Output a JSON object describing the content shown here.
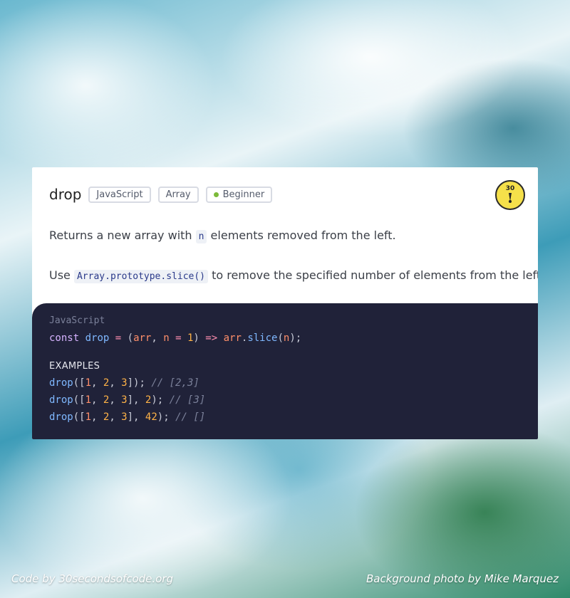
{
  "card": {
    "title": "drop",
    "tags": [
      {
        "label": "JavaScript"
      },
      {
        "label": "Array"
      },
      {
        "label": "Beginner",
        "dot_color": "#7cba3a"
      }
    ],
    "logo": {
      "text": "30"
    },
    "description": {
      "part1": "Returns a new array with ",
      "code": "n",
      "part2": " elements removed from the left."
    },
    "usage": {
      "part1": "Use ",
      "code": "Array.prototype.slice()",
      "part2": " to remove the specified number of elements from the left."
    }
  },
  "code": {
    "language_label": "JavaScript",
    "definition": {
      "const": "const",
      "name": "drop",
      "assign": "=",
      "open_paren": "(",
      "param1": "arr",
      "comma": ",",
      "param2": "n",
      "default_assign": "=",
      "default_value": "1",
      "close_paren": ")",
      "arrow": "=>",
      "target": "arr",
      "dot": ".",
      "method": "slice",
      "call_open": "(",
      "arg": "n",
      "call_close": ");"
    },
    "examples_label": "EXAMPLES",
    "examples": [
      {
        "fn": "drop",
        "args": [
          "1",
          "2",
          "3"
        ],
        "extra": "",
        "comment": "// [2,3]"
      },
      {
        "fn": "drop",
        "args": [
          "1",
          "2",
          "3"
        ],
        "extra": "2",
        "comment": "// [3]"
      },
      {
        "fn": "drop",
        "args": [
          "1",
          "2",
          "3"
        ],
        "extra": "42",
        "comment": "// []"
      }
    ]
  },
  "footer": {
    "left": "Code by 30secondsofcode.org",
    "right": "Background photo by Mike Marquez"
  },
  "colors": {
    "code_background": "#202239",
    "card_background": "#ffffff",
    "logo_yellow": "#f5e04a"
  }
}
